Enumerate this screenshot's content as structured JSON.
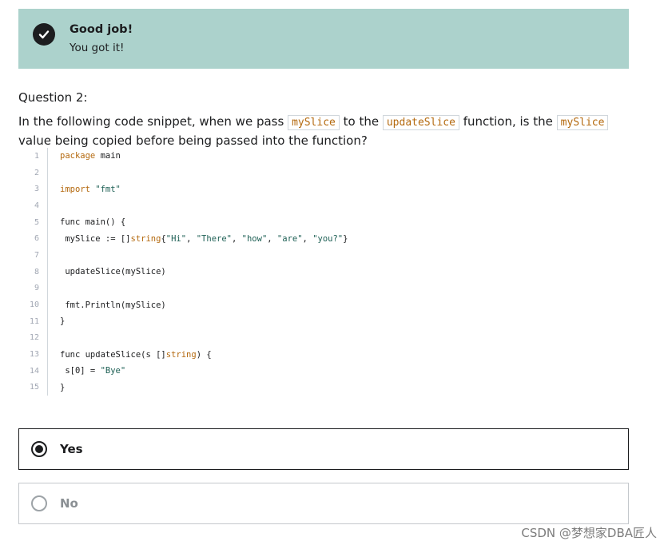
{
  "banner": {
    "title": "Good job!",
    "subtitle": "You got it!",
    "icon": "check-circle-icon",
    "color": "#acd2cc"
  },
  "question": {
    "label": "Question 2:",
    "text_parts": [
      "In the following code snippet, when we pass ",
      "mySlice",
      " to the ",
      "updateSlice",
      " function, is the ",
      "mySlice",
      " value being copied before being passed into the function?"
    ]
  },
  "code": {
    "line_numbers": [
      "1",
      "2",
      "3",
      "4",
      "5",
      "6",
      "7",
      "8",
      "9",
      "10",
      "11",
      "12",
      "13",
      "14",
      "15"
    ],
    "lines": [
      "package main",
      "",
      "import \"fmt\"",
      "",
      "func main() {",
      " mySlice := []string{\"Hi\", \"There\", \"how\", \"are\", \"you?\"}",
      "",
      " updateSlice(mySlice)",
      "",
      " fmt.Println(mySlice)",
      "}",
      "",
      "func updateSlice(s []string) {",
      " s[0] = \"Bye\"",
      "}"
    ]
  },
  "options": [
    {
      "label": "Yes",
      "selected": true
    },
    {
      "label": "No",
      "selected": false
    }
  ],
  "watermark": "CSDN @梦想家DBA匠人"
}
